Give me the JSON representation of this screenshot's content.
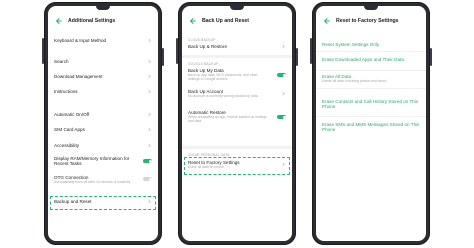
{
  "colors": {
    "accent": "#2bb36b",
    "link": "#2ea86a",
    "frame": "#2b2d33"
  },
  "screen1": {
    "title": "Additional Settings",
    "items": [
      {
        "label": "Keyboard & Input Method"
      },
      {
        "label": "Search"
      },
      {
        "label": "Download Management"
      },
      {
        "label": "Instructions"
      },
      {
        "label": "Automatic On/Off"
      },
      {
        "label": "SIM Card Apps"
      },
      {
        "label": "Accessibility"
      },
      {
        "label": "Display RAM/Memory Information for Recent Tasks"
      },
      {
        "label": "OTG Connection",
        "sub": "Automatically turns off after 10 minutes of inactivity"
      },
      {
        "label": "Backup and Reset"
      }
    ]
  },
  "screen2": {
    "title": "Back Up and Reset",
    "section1": "CLOUD BACKUP",
    "back_up_restore": "Back Up & Restore",
    "section2": "GOOGLE BACKUP",
    "back_up_my_data": "Back Up My Data",
    "back_up_my_data_sub": "Back up app data, Wi-Fi passwords, and other settings to Google servers",
    "backup_account": "Back Up Account",
    "backup_account_sub": "No account is currently storing backed up data",
    "automatic_restore": "Automatic Restore",
    "automatic_restore_sub": "When reinstalling an app, restore backed up settings and data",
    "section3": "CLEAR PERSONAL DATA",
    "reset_factory": "Reset to Factory Settings",
    "reset_factory_sub": "Erase all data on phone"
  },
  "screen3": {
    "title": "Reset to Factory Settings",
    "options": [
      {
        "label": "Reset System Settings Only",
        "sub": ""
      },
      {
        "label": "Erase Downloaded Apps and Their Data",
        "sub": ""
      },
      {
        "label": "Erase All Data",
        "sub": "Delete all data, including photos and music"
      },
      {
        "label": "Erase Contacts and Call History Stored on This Phone",
        "sub": ""
      },
      {
        "label": "Erase SMS and MMS Messages Stored on This Phone",
        "sub": ""
      }
    ]
  }
}
